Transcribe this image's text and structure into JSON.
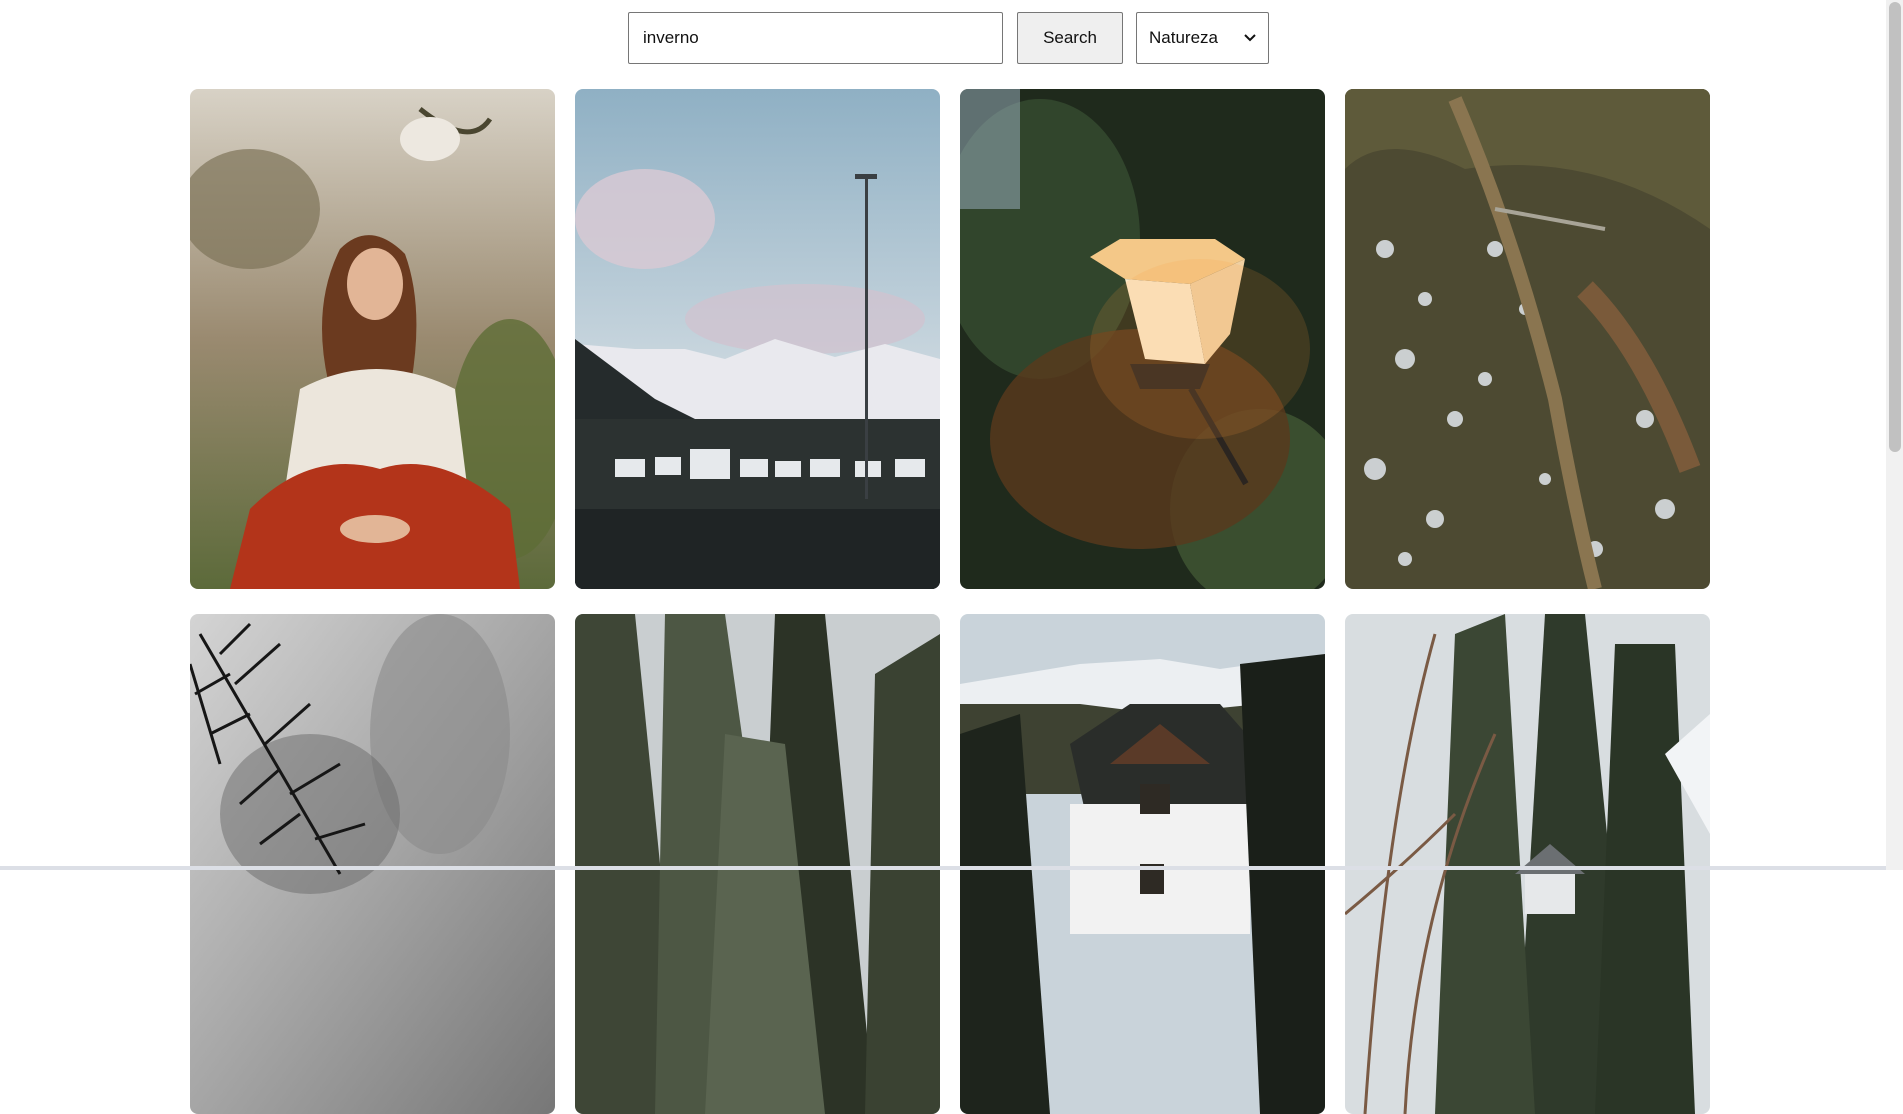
{
  "search": {
    "value": "inverno",
    "button_label": "Search",
    "category_selected": "Natureza"
  },
  "gallery": {
    "photos": [
      {
        "subject": "woman-with-red-blanket"
      },
      {
        "subject": "snowy-mountains-parking-lot"
      },
      {
        "subject": "street-lamp-in-pine"
      },
      {
        "subject": "aerial-snowy-village"
      },
      {
        "subject": "blurred-pine-branch"
      },
      {
        "subject": "dark-pine-trees"
      },
      {
        "subject": "chalet-with-mountains"
      },
      {
        "subject": "house-among-winter-trees"
      }
    ]
  },
  "colors": {
    "page_bg": "#ffffff",
    "button_bg": "#efefef",
    "border": "#767676"
  }
}
